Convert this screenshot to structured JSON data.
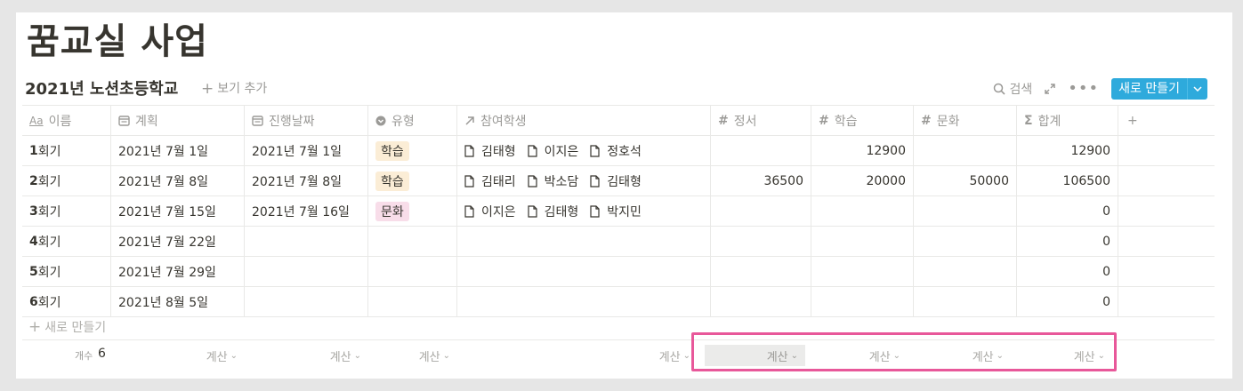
{
  "page": {
    "title": "꿈교실 사업"
  },
  "database": {
    "title": "2021년 노션초등학교",
    "add_view": "보기 추가"
  },
  "toolbar": {
    "search": "검색",
    "new_label": "새로 만들기"
  },
  "columns": [
    {
      "label": "이름",
      "icon": "title-aa-icon"
    },
    {
      "label": "계획",
      "icon": "calendar-icon"
    },
    {
      "label": "진행날짜",
      "icon": "calendar-icon"
    },
    {
      "label": "유형",
      "icon": "select-icon"
    },
    {
      "label": "참여학생",
      "icon": "relation-arrow-icon"
    },
    {
      "label": "정서",
      "icon": "hash-icon"
    },
    {
      "label": "학습",
      "icon": "hash-icon"
    },
    {
      "label": "문화",
      "icon": "hash-icon"
    },
    {
      "label": "합계",
      "icon": "sigma-icon"
    }
  ],
  "rows": [
    {
      "num": "1",
      "name": "회기",
      "plan": "2021년 7월 1일",
      "date": "2021년 7월 1일",
      "type": "학습",
      "type_color": "#fbedd6",
      "students": [
        "김태형",
        "이지은",
        "정호석"
      ],
      "emotion": "",
      "study": "12900",
      "culture": "",
      "total": "12900"
    },
    {
      "num": "2",
      "name": "회기",
      "plan": "2021년 7월 8일",
      "date": "2021년 7월 8일",
      "type": "학습",
      "type_color": "#fbedd6",
      "students": [
        "김태리",
        "박소담",
        "김태형"
      ],
      "emotion": "36500",
      "study": "20000",
      "culture": "50000",
      "total": "106500"
    },
    {
      "num": "3",
      "name": "회기",
      "plan": "2021년 7월 15일",
      "date": "2021년 7월 16일",
      "type": "문화",
      "type_color": "#f8dde9",
      "students": [
        "이지은",
        "김태형",
        "박지민"
      ],
      "emotion": "",
      "study": "",
      "culture": "",
      "total": "0"
    },
    {
      "num": "4",
      "name": "회기",
      "plan": "2021년 7월 22일",
      "date": "",
      "type": "",
      "type_color": "",
      "students": [],
      "emotion": "",
      "study": "",
      "culture": "",
      "total": "0"
    },
    {
      "num": "5",
      "name": "회기",
      "plan": "2021년 7월 29일",
      "date": "",
      "type": "",
      "type_color": "",
      "students": [],
      "emotion": "",
      "study": "",
      "culture": "",
      "total": "0"
    },
    {
      "num": "6",
      "name": "회기",
      "plan": "2021년 8월 5일",
      "date": "",
      "type": "",
      "type_color": "",
      "students": [],
      "emotion": "",
      "study": "",
      "culture": "",
      "total": "0"
    }
  ],
  "new_row_label": "새로 만들기",
  "footer": {
    "count_label": "개수",
    "count_value": "6",
    "calc_label": "계산"
  },
  "colors": {
    "accent": "#2eaadc",
    "highlight": "#e8589a"
  }
}
